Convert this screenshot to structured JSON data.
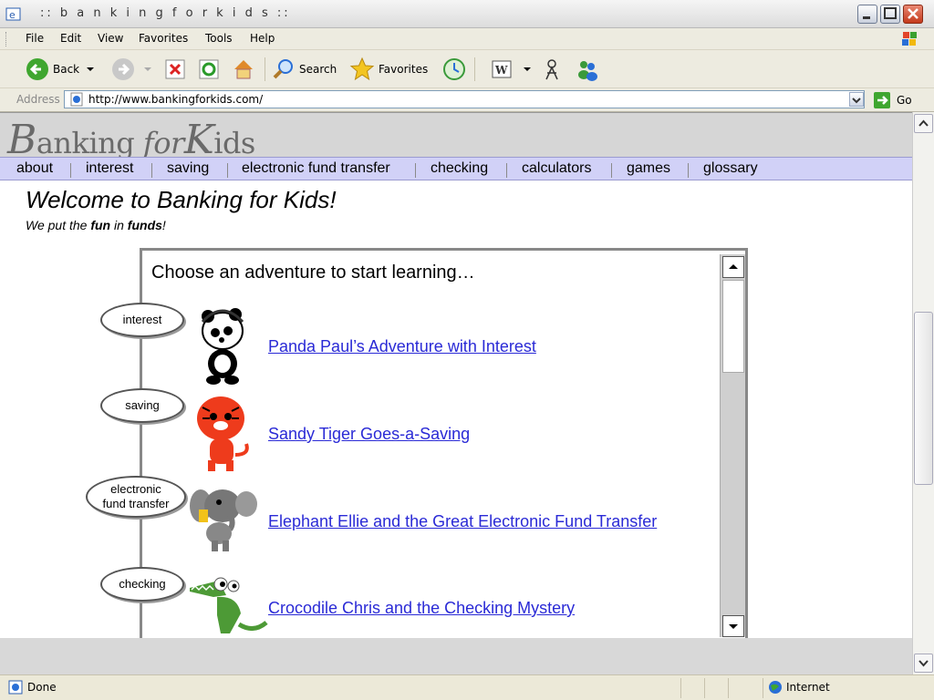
{
  "window": {
    "title": ":: b a n k i n g f o r k i d s ::"
  },
  "menu": [
    "File",
    "Edit",
    "View",
    "Favorites",
    "Tools",
    "Help"
  ],
  "toolbar": {
    "back": "Back",
    "search": "Search",
    "favorites": "Favorites"
  },
  "address": {
    "label": "Address",
    "url": "http://www.bankingforkids.com/",
    "go": "Go"
  },
  "site": {
    "logo": {
      "b": "B",
      "anking": "anking ",
      "for": "for",
      "k": "K",
      "ids": "ids"
    },
    "nav": [
      "about",
      "interest",
      "saving",
      "electronic fund transfer",
      "checking",
      "calculators",
      "games",
      "glossary"
    ],
    "welcome": "Welcome to Banking for Kids!",
    "tagline": {
      "pre": "We put the ",
      "fun": "fun",
      "mid": " in ",
      "funds": "funds",
      "post": "!"
    },
    "frame_title": "Choose an adventure to start learning…",
    "adventures": [
      {
        "bubble": "interest",
        "link": "Panda Paul’s Adventure with Interest"
      },
      {
        "bubble": "saving",
        "link": "Sandy Tiger Goes-a-Saving"
      },
      {
        "bubble": "electronic fund transfer",
        "bubble_line1": "electronic",
        "bubble_line2": "fund transfer",
        "link": "Elephant Ellie and the Great Electronic Fund Transfer"
      },
      {
        "bubble": "checking",
        "link": "Crocodile Chris and the Checking Mystery"
      }
    ]
  },
  "status": {
    "text": "Done",
    "zone": "Internet"
  },
  "colors": {
    "nav_bg": "#d1d1f7",
    "link": "#2a2ad6",
    "header_bg": "#d6d6d6"
  }
}
